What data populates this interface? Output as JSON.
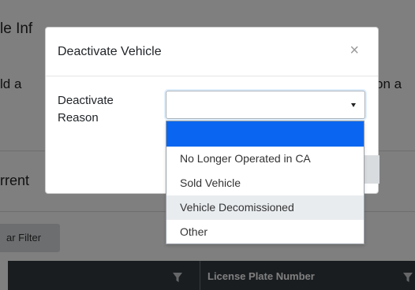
{
  "background": {
    "section_title": "le Inf",
    "line2_left": "ld a",
    "line2_right": "on a",
    "current_heading": "rrent",
    "clear_filter_label": "ar Filter",
    "table_header": {
      "column_2_label": "License Plate Number"
    }
  },
  "modal": {
    "title": "Deactivate Vehicle",
    "close_symbol": "×",
    "field_label": "Deactivate Reason",
    "select_value": "",
    "options": [
      {
        "label": "",
        "state": "selected"
      },
      {
        "label": "No Longer Operated in CA",
        "state": "normal"
      },
      {
        "label": "Sold Vehicle",
        "state": "normal"
      },
      {
        "label": "Vehicle Decomissioned",
        "state": "hover"
      },
      {
        "label": "Other",
        "state": "normal"
      }
    ]
  },
  "colors": {
    "selected_option": "#0a66f0",
    "hover_option": "#e9ecef",
    "table_header_bg": "#343a40"
  },
  "icons": [
    "close-icon",
    "caret-down-icon",
    "filter-icon"
  ]
}
